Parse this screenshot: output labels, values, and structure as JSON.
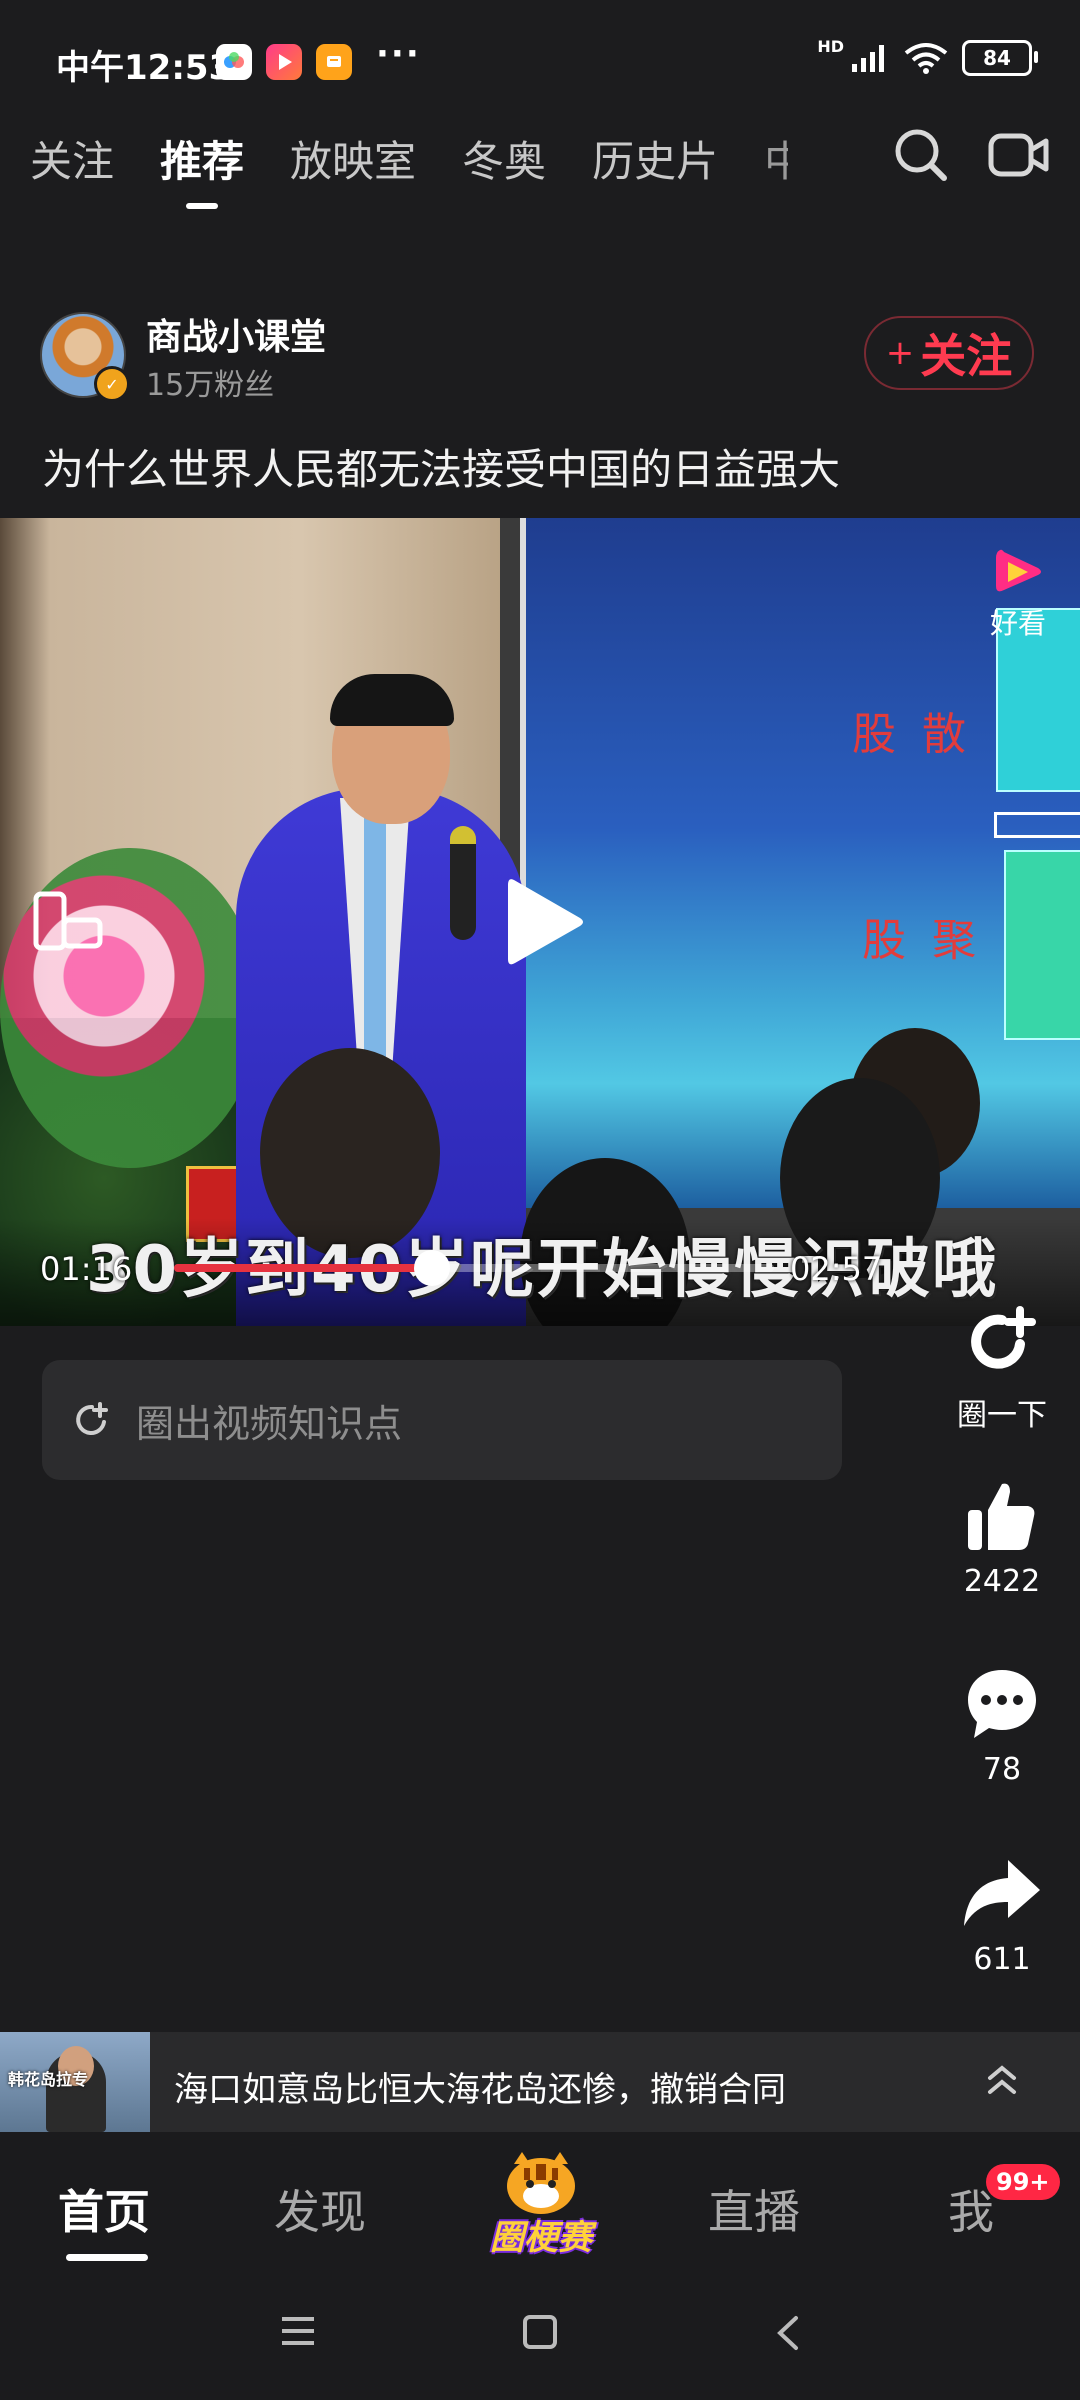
{
  "status_bar": {
    "time": "中午12:53",
    "more": "···",
    "battery": "84",
    "network": "HD"
  },
  "top_tabs": [
    {
      "label": "关注"
    },
    {
      "label": "推荐"
    },
    {
      "label": "放映室"
    },
    {
      "label": "冬奥"
    },
    {
      "label": "历史片"
    },
    {
      "label": "中"
    }
  ],
  "post": {
    "author": "商战小课堂",
    "fans": "15万粉丝",
    "follow_label": "关注",
    "follow_plus": "+",
    "title": "为什么世界人民都无法接受中国的日益强大"
  },
  "video": {
    "slide_text_1": "股 散",
    "slide_text_2": "股 聚",
    "watermark": "好看",
    "subtitle": "30岁到40岁呢开始慢慢识破哦",
    "time_current": "01:16",
    "time_total": "02:57",
    "progress": 0.43
  },
  "knowledge_bar": {
    "placeholder": "圈出视频知识点"
  },
  "actions": {
    "circle_label": "圈一下",
    "like_count": "2422",
    "comment_count": "78",
    "share_count": "611"
  },
  "news_ticker": {
    "thumb_caption": "韩花岛拉专",
    "text": "海口如意岛比恒大海花岛还惨，撤销合同"
  },
  "bottom_nav": {
    "home": "首页",
    "discover": "发现",
    "center_label": "圈梗赛",
    "live": "直播",
    "me": "我",
    "me_badge": "99+"
  },
  "colors": {
    "accent_red": "#ff3b50",
    "progress_red": "#e6323f",
    "background": "#1c1c1e"
  }
}
